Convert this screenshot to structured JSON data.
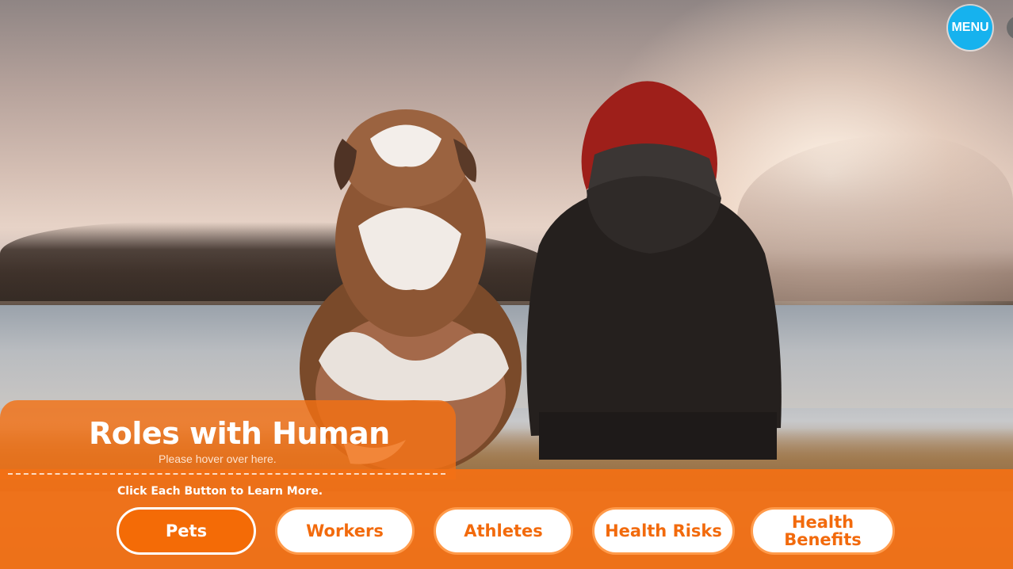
{
  "menu": {
    "label": "MENU"
  },
  "panel": {
    "title": "Roles with Human",
    "hint": "Please hover over here.",
    "instructions": "Click Each Button to Learn More."
  },
  "buttons": [
    {
      "label": "Pets",
      "active": true
    },
    {
      "label": "Workers",
      "active": false
    },
    {
      "label": "Athletes",
      "active": false
    },
    {
      "label": "Health Risks",
      "active": false
    },
    {
      "label": "Health Benefits",
      "active": false
    }
  ],
  "colors": {
    "accent_orange": "#f37014",
    "menu_blue": "#16b2ee",
    "button_text": "#f26a0c"
  }
}
